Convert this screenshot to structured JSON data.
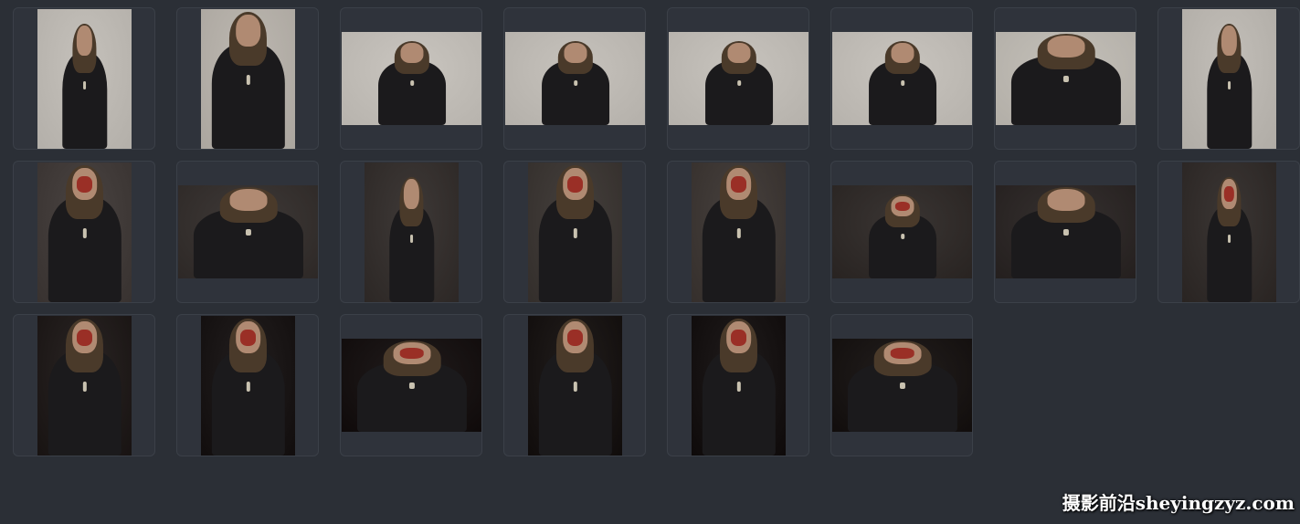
{
  "watermark": {
    "text": "摄影前沿sheyingzyz.com"
  },
  "thumbnails": [
    {
      "orientation": "portrait",
      "background": "#c5c1bb",
      "blood": false,
      "pose": "standing-axe-behind-head"
    },
    {
      "orientation": "portrait",
      "background": "#bdb8b1",
      "blood": false,
      "pose": "closeup-leaning-on-axe"
    },
    {
      "orientation": "landscape",
      "background": "#c9c5bf",
      "blood": false,
      "pose": "standing-full"
    },
    {
      "orientation": "landscape",
      "background": "#c6c2bc",
      "blood": false,
      "pose": "standing-sword-shield"
    },
    {
      "orientation": "landscape",
      "background": "#c7c3bd",
      "blood": false,
      "pose": "pointing-sword-shield"
    },
    {
      "orientation": "landscape",
      "background": "#c8c4be",
      "blood": false,
      "pose": "pointing"
    },
    {
      "orientation": "landscape",
      "background": "#c4c0b9",
      "blood": false,
      "pose": "portrait-bust"
    },
    {
      "orientation": "portrait",
      "background": "#c2beb8",
      "blood": false,
      "pose": "standing-full"
    },
    {
      "orientation": "portrait",
      "background": "#4a4442",
      "blood": true,
      "pose": "portrait-bust"
    },
    {
      "orientation": "landscape",
      "background": "#3f3a38",
      "blood": false,
      "pose": "portrait-bust"
    },
    {
      "orientation": "portrait",
      "background": "#3e3937",
      "blood": false,
      "pose": "standing-full"
    },
    {
      "orientation": "portrait",
      "background": "#45403d",
      "blood": true,
      "pose": "closeup"
    },
    {
      "orientation": "portrait",
      "background": "#47413e",
      "blood": true,
      "pose": "closeup-turned"
    },
    {
      "orientation": "landscape",
      "background": "#3a3533",
      "blood": true,
      "pose": "bloodied-hand"
    },
    {
      "orientation": "landscape",
      "background": "#363130",
      "blood": false,
      "pose": "portrait-bust"
    },
    {
      "orientation": "portrait",
      "background": "#3b3634",
      "blood": true,
      "pose": "standing-full"
    },
    {
      "orientation": "portrait",
      "background": "#2a2524",
      "blood": true,
      "pose": "profile-shouting"
    },
    {
      "orientation": "portrait",
      "background": "#231f1f",
      "blood": true,
      "pose": "profile-shouting"
    },
    {
      "orientation": "landscape",
      "background": "#211c1c",
      "blood": true,
      "pose": "profile-crouch"
    },
    {
      "orientation": "portrait",
      "background": "#221e1d",
      "blood": true,
      "pose": "profile-crouch"
    },
    {
      "orientation": "portrait",
      "background": "#201c1c",
      "blood": true,
      "pose": "profile-crouch"
    },
    {
      "orientation": "landscape",
      "background": "#231f1e",
      "blood": true,
      "pose": "profile-crouch"
    }
  ]
}
